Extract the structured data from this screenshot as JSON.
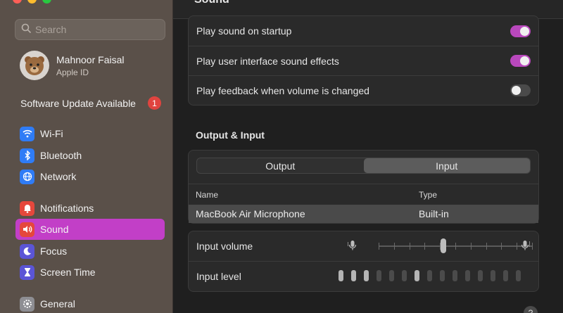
{
  "search": {
    "placeholder": "Search"
  },
  "profile": {
    "name": "Mahnoor Faisal",
    "subtitle": "Apple ID"
  },
  "software_update": {
    "label": "Software Update Available",
    "badge": "1"
  },
  "sidebar": {
    "items": [
      {
        "label": "Wi-Fi",
        "icon": "wifi-icon",
        "color": "#2f7cf6"
      },
      {
        "label": "Bluetooth",
        "icon": "bluetooth-icon",
        "color": "#2f7cf6"
      },
      {
        "label": "Network",
        "icon": "globe-icon",
        "color": "#2f7cf6"
      },
      {
        "label": "Notifications",
        "icon": "bell-icon",
        "color": "#e5473c"
      },
      {
        "label": "Sound",
        "icon": "speaker-icon",
        "color": "#e5473c",
        "selected": true
      },
      {
        "label": "Focus",
        "icon": "moon-icon",
        "color": "#5b55d6"
      },
      {
        "label": "Screen Time",
        "icon": "hourglass-icon",
        "color": "#5b55d6"
      },
      {
        "label": "General",
        "icon": "gear-icon",
        "color": "#8e8e93"
      }
    ]
  },
  "header": {
    "title": "Sound"
  },
  "sound_effects": {
    "rows": [
      {
        "label": "Play sound on startup",
        "on": true
      },
      {
        "label": "Play user interface sound effects",
        "on": true
      },
      {
        "label": "Play feedback when volume is changed",
        "on": false
      }
    ]
  },
  "output_input": {
    "title": "Output & Input",
    "tabs": [
      {
        "label": "Output",
        "active": false
      },
      {
        "label": "Input",
        "active": true
      }
    ],
    "columns": {
      "name": "Name",
      "type": "Type"
    },
    "devices": [
      {
        "name": "MacBook Air Microphone",
        "type": "Built-in"
      }
    ]
  },
  "input": {
    "volume_label": "Input volume",
    "level_label": "Input level",
    "volume_fraction": 0.42,
    "level_bars_total": 15,
    "level_bars_on": [
      0,
      1,
      2,
      6
    ]
  },
  "help": {
    "label": "?"
  },
  "colors": {
    "accent": "#c23fc7",
    "toggle_on": "#b948bd",
    "toggle_off": "#4a4a4a",
    "badge": "#e0443f"
  }
}
